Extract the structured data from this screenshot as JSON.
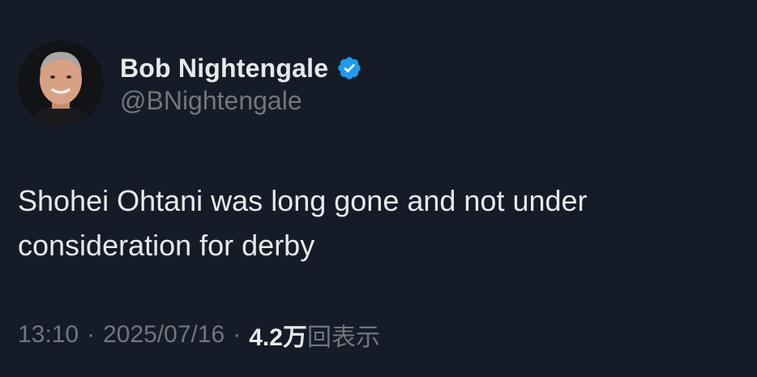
{
  "tweet": {
    "display_name": "Bob Nightengale",
    "handle": "@BNightengale",
    "verified_icon": "verified-badge-icon",
    "text": "Shohei Ohtani was long gone and not under consideration for derby",
    "time": "13:10",
    "date": "2025/07/16",
    "separator": "·",
    "views_count": "4.2万",
    "views_label": "回表示"
  },
  "colors": {
    "background": "#151c28",
    "primary_text": "#e7e9ea",
    "secondary_text": "#71767b",
    "verified_blue": "#1d9bf0"
  }
}
